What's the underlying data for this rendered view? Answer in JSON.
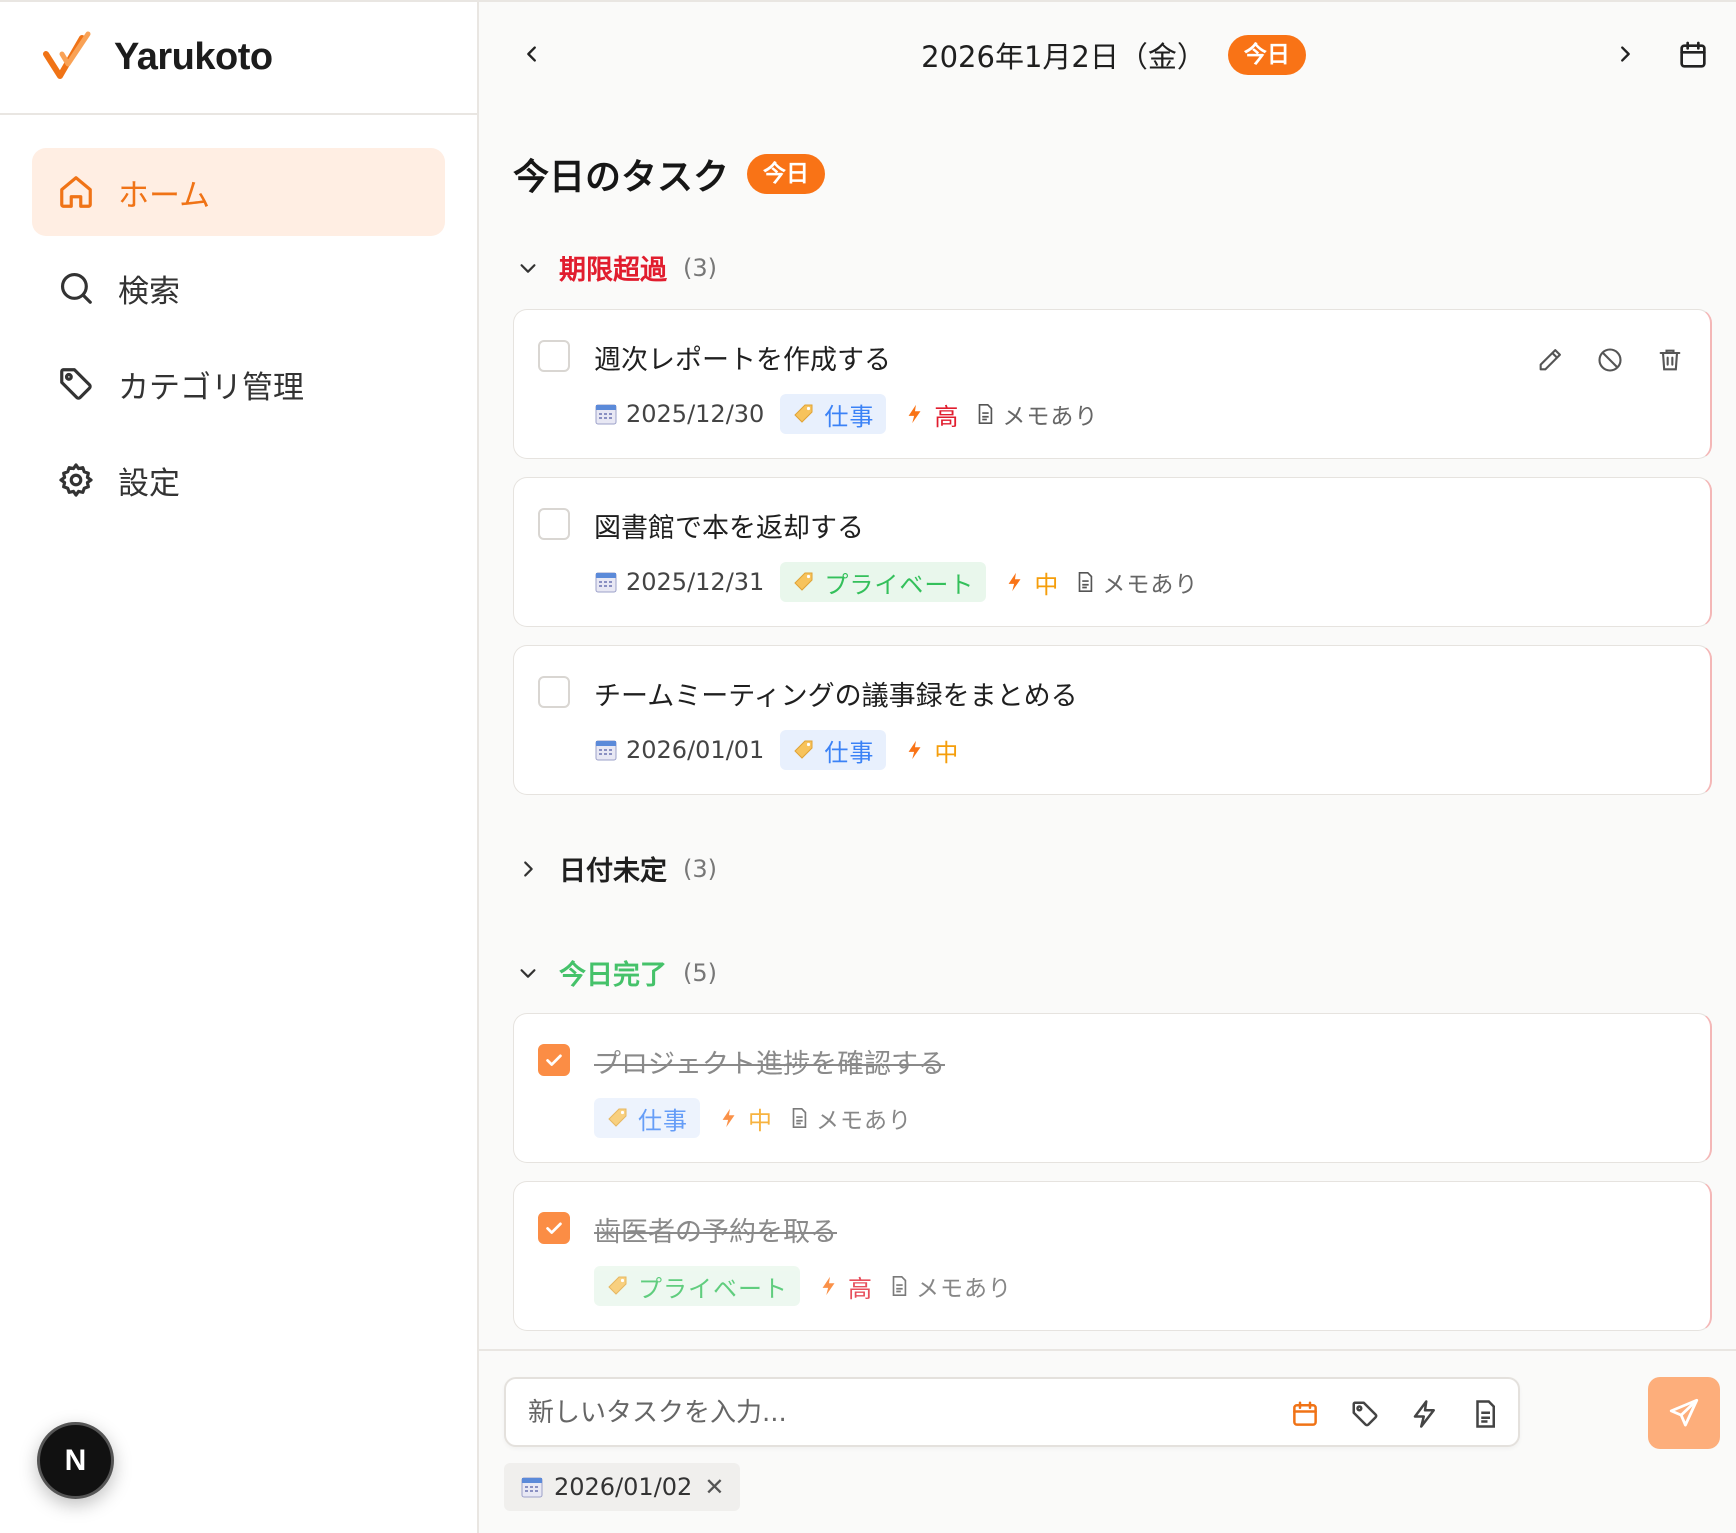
{
  "brand": {
    "name": "Yarukoto",
    "logo_color": "#f07316"
  },
  "sidebar": {
    "items": [
      {
        "label": "ホーム",
        "icon": "home-icon",
        "active": true
      },
      {
        "label": "検索",
        "icon": "search-icon",
        "active": false
      },
      {
        "label": "カテゴリ管理",
        "icon": "tag-icon",
        "active": false
      },
      {
        "label": "設定",
        "icon": "gear-icon",
        "active": false
      }
    ],
    "badge": "N"
  },
  "topbar": {
    "date": "2026年1月2日（金）",
    "today_label": "今日"
  },
  "page": {
    "title": "今日のタスク",
    "today_badge": "今日"
  },
  "sections": {
    "overdue": {
      "label": "期限超過",
      "count": "(3)",
      "color": "#e11d2e"
    },
    "undated": {
      "label": "日付未定",
      "count": "(3)"
    },
    "done_today": {
      "label": "今日完了",
      "count": "(5)",
      "color": "#45c26a"
    }
  },
  "overdue_tasks": [
    {
      "title": "週次レポートを作成する",
      "date": "2025/12/30",
      "category": "仕事",
      "priority": "高",
      "memo": "メモあり"
    },
    {
      "title": "図書館で本を返却する",
      "date": "2025/12/31",
      "category": "プライベート",
      "priority": "中",
      "memo": "メモあり"
    },
    {
      "title": "チームミーティングの議事録をまとめる",
      "date": "2026/01/01",
      "category": "仕事",
      "priority": "中"
    }
  ],
  "done_tasks": [
    {
      "title": "プロジェクト進捗を確認する",
      "category": "仕事",
      "priority": "中",
      "memo": "メモあり"
    },
    {
      "title": "歯医者の予約を取る",
      "category": "プライベート",
      "priority": "高",
      "memo": "メモあり"
    }
  ],
  "composer": {
    "placeholder": "新しいタスクを入力...",
    "selected_date": "2026/01/02",
    "remove": "✕"
  },
  "colors": {
    "accent": "#f97316",
    "priority_high": "#e11d2e",
    "priority_mid": "#f59e0b",
    "work": "#3b82f6",
    "private": "#34c05b"
  }
}
